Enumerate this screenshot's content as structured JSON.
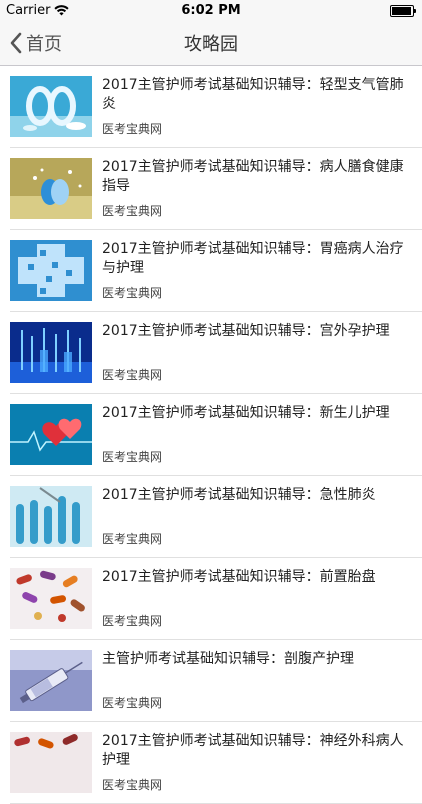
{
  "status_bar": {
    "carrier": "Carrier",
    "time": "6:02 PM",
    "battery_level": 0.95
  },
  "nav": {
    "back_label": "首页",
    "title": "攻略园"
  },
  "articles": [
    {
      "title": "2017主管护师考试基础知识辅导：轻型支气管肺炎",
      "source": "医考宝典网",
      "thumb": "pills-blue"
    },
    {
      "title": "2017主管护师考试基础知识辅导：病人膳食健康指导",
      "source": "医考宝典网",
      "thumb": "pills-gold"
    },
    {
      "title": "2017主管护师考试基础知识辅导：胃癌病人治疗与护理",
      "source": "医考宝典网",
      "thumb": "cross-blue"
    },
    {
      "title": "2017主管护师考试基础知识辅导：宫外孕护理",
      "source": "医考宝典网",
      "thumb": "syringes-blue"
    },
    {
      "title": "2017主管护师考试基础知识辅导：新生儿护理",
      "source": "医考宝典网",
      "thumb": "hearts-ecg"
    },
    {
      "title": "2017主管护师考试基础知识辅导：急性肺炎",
      "source": "医考宝典网",
      "thumb": "test-tubes"
    },
    {
      "title": "2017主管护师考试基础知识辅导：前置胎盘",
      "source": "医考宝典网",
      "thumb": "capsules"
    },
    {
      "title": "主管护师考试基础知识辅导：剖腹产护理",
      "source": "医考宝典网",
      "thumb": "syringe-purple"
    },
    {
      "title": "2017主管护师考试基础知识辅导：神经外科病人护理",
      "source": "医考宝典网",
      "thumb": "capsules-red"
    }
  ]
}
